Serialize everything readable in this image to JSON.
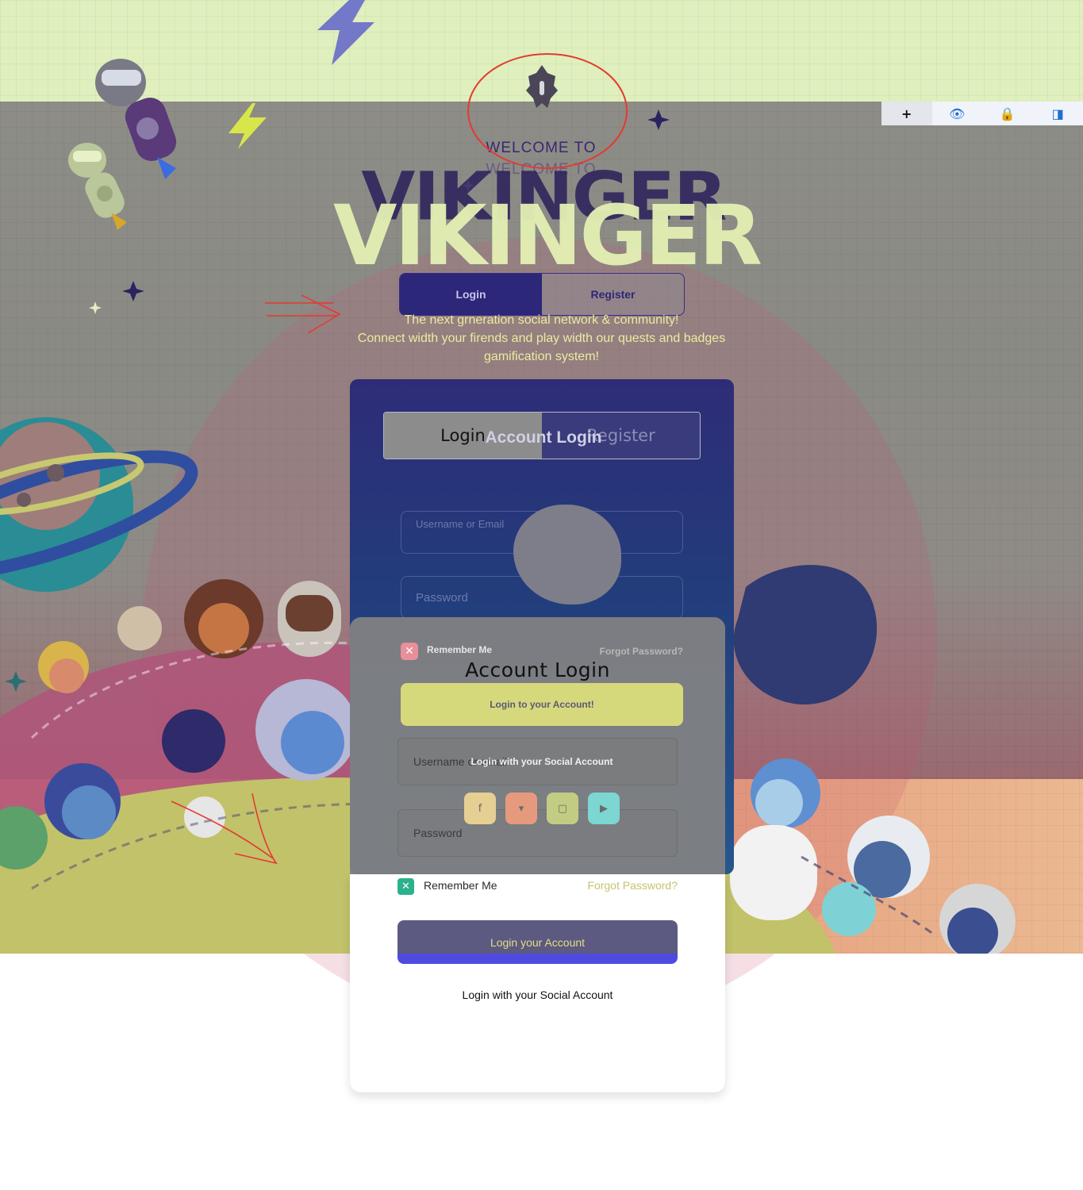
{
  "toolbar": {
    "items": [
      {
        "icon": "plus-icon",
        "glyph": "+"
      },
      {
        "icon": "eye-icon",
        "glyph": "👁"
      },
      {
        "icon": "lock-icon",
        "glyph": "🔒"
      },
      {
        "icon": "outlook-icon",
        "glyph": "◨"
      }
    ]
  },
  "hero": {
    "welcome": "WELCOME TO",
    "welcome_ghost": "WELCOME TO",
    "brand": "VIKINGER",
    "brand_ghost": "VIKINGER",
    "tabs": {
      "login": "Login",
      "register": "Register"
    },
    "tagline_1": "The next grneration social network & community!",
    "tagline_2": "Connect width your firends and play width our quests and badges",
    "tagline_3": "gamification system!"
  },
  "blue_form": {
    "tabs": {
      "login": "Login",
      "register": "Register"
    },
    "title": "Account Login",
    "username_label": "Username or Email",
    "password_label": "Password"
  },
  "gray_form": {
    "remember": "Remember Me",
    "forgot": "Forgot Password?",
    "title": "Account Login",
    "login_button": "Login to your Account!",
    "social_text": "Login with your Social Account"
  },
  "white_form": {
    "username_placeholder": "Username or email",
    "password_placeholder": "Password",
    "remember": "Remember Me",
    "forgot": "Forgot Password?",
    "login_button": "Login your Account",
    "social_text": "Login with your Social Account"
  },
  "colors": {
    "lime": "#dfefbd",
    "navy": "#2c2778",
    "accent_yellow": "#d6d87c",
    "accent_green": "#2bb18c",
    "accent_blue": "#4f4be0"
  }
}
